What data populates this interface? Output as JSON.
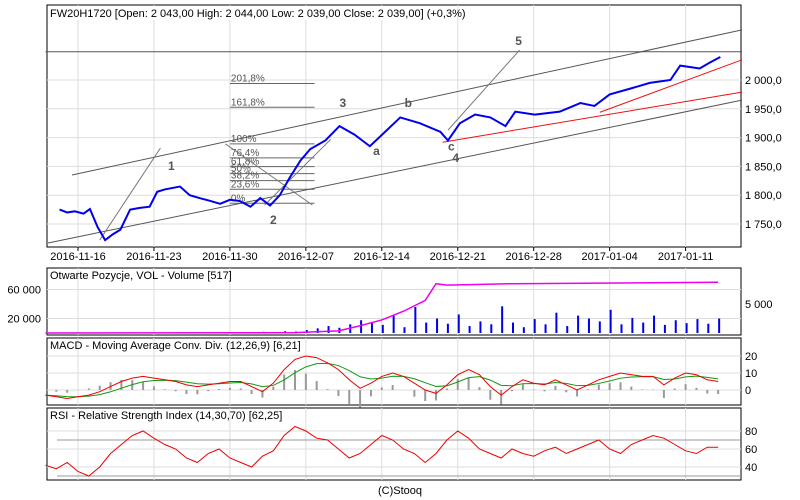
{
  "chart_data": [
    {
      "type": "line",
      "title": "FW20H1720 [Open: 2 043,00  High: 2 044,00  Low: 2 039,00  Close: 2 039,00] (+0,3%)",
      "x_unit": "days since 2016-11-16",
      "x_ticks": [
        {
          "day": 0,
          "label": "2016-11-16"
        },
        {
          "day": 7,
          "label": "2016-11-23"
        },
        {
          "day": 14,
          "label": "2016-11-30"
        },
        {
          "day": 21,
          "label": "2016-12-07"
        },
        {
          "day": 28,
          "label": "2016-12-14"
        },
        {
          "day": 35,
          "label": "2016-12-21"
        },
        {
          "day": 42,
          "label": "2016-12-28"
        },
        {
          "day": 49,
          "label": "2017-01-04"
        },
        {
          "day": 56,
          "label": "2017-01-11"
        }
      ],
      "y_ticks": [
        {
          "v": 2000,
          "label": "2 000,0"
        },
        {
          "v": 1950,
          "label": "1 950,0"
        },
        {
          "v": 1900,
          "label": "1 900,0"
        },
        {
          "v": 1850,
          "label": "1 850,0"
        },
        {
          "v": 1800,
          "label": "1 800,0"
        },
        {
          "v": 1750,
          "label": "1 750,0"
        }
      ],
      "price": [
        [
          -1.7,
          1775
        ],
        [
          -1,
          1770
        ],
        [
          -0.3,
          1772
        ],
        [
          0.5,
          1768
        ],
        [
          1.1,
          1776
        ],
        [
          1.8,
          1745
        ],
        [
          2.5,
          1722
        ],
        [
          3.2,
          1732
        ],
        [
          3.9,
          1740
        ],
        [
          4.8,
          1775
        ],
        [
          5.7,
          1778
        ],
        [
          6.6,
          1780
        ],
        [
          7.3,
          1806
        ],
        [
          8,
          1810
        ],
        [
          9.4,
          1815
        ],
        [
          10.3,
          1800
        ],
        [
          11.2,
          1795
        ],
        [
          12.2,
          1790
        ],
        [
          13.1,
          1785
        ],
        [
          14,
          1792
        ],
        [
          14.9,
          1790
        ],
        [
          15.9,
          1780
        ],
        [
          16.8,
          1795
        ],
        [
          17.7,
          1782
        ],
        [
          18.6,
          1800
        ],
        [
          19.5,
          1830
        ],
        [
          20.5,
          1860
        ],
        [
          21.4,
          1880
        ],
        [
          22.8,
          1895
        ],
        [
          24.1,
          1920
        ],
        [
          25.5,
          1905
        ],
        [
          26.9,
          1885
        ],
        [
          28.3,
          1910
        ],
        [
          29.7,
          1935
        ],
        [
          31.5,
          1925
        ],
        [
          33.4,
          1910
        ],
        [
          34.1,
          1895
        ],
        [
          35.2,
          1925
        ],
        [
          36.6,
          1940
        ],
        [
          38,
          1935
        ],
        [
          39.4,
          1920
        ],
        [
          40.3,
          1945
        ],
        [
          42.1,
          1940
        ],
        [
          44.4,
          1945
        ],
        [
          46.3,
          1960
        ],
        [
          47.6,
          1955
        ],
        [
          49,
          1975
        ],
        [
          50.9,
          1985
        ],
        [
          52.7,
          1995
        ],
        [
          54.6,
          2000
        ],
        [
          55.5,
          2025
        ],
        [
          57.3,
          2020
        ],
        [
          58.2,
          2030
        ],
        [
          59.2,
          2040
        ]
      ],
      "lines": [
        {
          "color": "#555555",
          "p": [
            -0.55,
            1835,
            61.2,
            2087
          ]
        },
        {
          "color": "#555555",
          "p": [
            -2.76,
            1717,
            61.2,
            1965
          ]
        },
        {
          "color": "#ee1111",
          "p": [
            33.6,
            1892,
            61.2,
            1979
          ]
        },
        {
          "color": "#ee1111",
          "p": [
            48.1,
            1944,
            61.2,
            2035
          ]
        },
        {
          "color": "#555555",
          "p": [
            -3,
            2049,
            61.2,
            2049
          ]
        },
        {
          "color": "#777777",
          "p": [
            34.1,
            1913,
            40.7,
            2052
          ]
        },
        {
          "color": "#777777",
          "p": [
            2,
            1722,
            7.6,
            1882
          ]
        },
        {
          "color": "#777777",
          "p": [
            13.6,
            1889,
            21.6,
            1783
          ]
        },
        {
          "color": "#777777",
          "p": [
            17.2,
            1783,
            23.3,
            1897
          ]
        }
      ],
      "fib": {
        "day_from": 14,
        "day_to": 21.8,
        "low": 1786,
        "high": 1889,
        "levels": [
          {
            "r": 2.018,
            "label": "201,8%"
          },
          {
            "r": 1.618,
            "label": "161,8%"
          },
          {
            "r": 1,
            "label": "100%"
          },
          {
            "r": 0.764,
            "label": "76,4%"
          },
          {
            "r": 0.618,
            "label": "61,8%"
          },
          {
            "r": 0.5,
            "label": "50%"
          },
          {
            "r": 0.382,
            "label": "38,2%"
          },
          {
            "r": 0.236,
            "label": "23,6%"
          },
          {
            "r": 0,
            "label": "0%"
          }
        ]
      },
      "waves": [
        {
          "t": "1",
          "day": 8.3,
          "v": 1844
        },
        {
          "t": "2",
          "day": 17.7,
          "v": 1750
        },
        {
          "t": "3",
          "day": 24.1,
          "v": 1953
        },
        {
          "t": "4",
          "day": 34.5,
          "v": 1858
        },
        {
          "t": "5",
          "day": 40.3,
          "v": 2061
        },
        {
          "t": "a",
          "day": 27.2,
          "v": 1870
        },
        {
          "t": "b",
          "day": 30.1,
          "v": 1953
        },
        {
          "t": "c",
          "day": 34.1,
          "v": 1878
        }
      ]
    },
    {
      "type": "bar",
      "title": "Otwarte Pozycje, VOL - Volume [517]",
      "left_ticks": [
        {
          "v": 60000,
          "label": "60 000"
        },
        {
          "v": 20000,
          "label": "20 000"
        }
      ],
      "right_ticks": [
        {
          "v": 5000,
          "label": "5 000"
        }
      ],
      "volume": [
        50,
        30,
        40,
        60,
        80,
        40,
        30,
        60,
        100,
        50,
        40,
        30,
        80,
        40,
        60,
        50,
        30,
        40,
        90,
        120,
        200,
        150,
        300,
        250,
        500,
        800,
        1200,
        900,
        1500,
        2200,
        1800,
        1400,
        3000,
        1000,
        4500,
        1800,
        2500,
        1600,
        3200,
        1200,
        2000,
        1500,
        4600,
        1800,
        1000,
        2400,
        1500,
        3500,
        1200,
        3000,
        2500,
        2000,
        4000,
        1500,
        2600,
        1800,
        3000,
        1400,
        2200,
        1700,
        2400,
        1600,
        2500
      ],
      "open_interest": [
        [
          -3,
          0
        ],
        [
          20,
          500
        ],
        [
          24,
          3000
        ],
        [
          26,
          10000
        ],
        [
          28,
          18000
        ],
        [
          30,
          30000
        ],
        [
          32,
          45000
        ],
        [
          33,
          68000
        ],
        [
          34,
          66000
        ],
        [
          40,
          68000
        ],
        [
          59,
          70000
        ]
      ]
    },
    {
      "type": "line",
      "title": "MACD - Moving Average Conv. Div. (12,26,9) [6,21]",
      "y_ticks": [
        {
          "v": 20,
          "label": "20"
        },
        {
          "v": 10,
          "label": "10"
        },
        {
          "v": 0,
          "label": "0"
        }
      ],
      "start_day": -3,
      "macd": [
        -3,
        -4,
        -5,
        -4,
        -3,
        -1,
        2,
        5,
        7,
        8,
        7,
        6,
        5,
        3,
        2,
        3,
        4,
        5,
        5,
        2,
        -1,
        4,
        12,
        18,
        20,
        19,
        16,
        12,
        6,
        1,
        4,
        8,
        10,
        8,
        4,
        0,
        -2,
        3,
        9,
        12,
        9,
        2,
        -3,
        2,
        6,
        4,
        3,
        6,
        3,
        0,
        3,
        6,
        8,
        10,
        9,
        8,
        8,
        3,
        7,
        10,
        9,
        6,
        5
      ]
    },
    {
      "type": "line",
      "title": "RSI - Relative Strength Index (14,30,70) [62,25]",
      "y_ticks": [
        {
          "v": 80,
          "label": "80"
        },
        {
          "v": 60,
          "label": "60"
        },
        {
          "v": 40,
          "label": "40"
        }
      ],
      "bands": [
        70,
        30
      ],
      "start_day": -3,
      "rsi": [
        42,
        38,
        45,
        35,
        30,
        40,
        55,
        65,
        75,
        80,
        72,
        65,
        60,
        50,
        45,
        55,
        60,
        50,
        45,
        40,
        52,
        58,
        75,
        85,
        80,
        72,
        70,
        60,
        50,
        55,
        65,
        75,
        70,
        60,
        55,
        45,
        55,
        70,
        80,
        72,
        60,
        55,
        50,
        60,
        55,
        52,
        58,
        62,
        55,
        60,
        65,
        70,
        60,
        55,
        65,
        70,
        75,
        72,
        65,
        58,
        55,
        62,
        62
      ]
    }
  ],
  "footer": "(C)Stooq"
}
